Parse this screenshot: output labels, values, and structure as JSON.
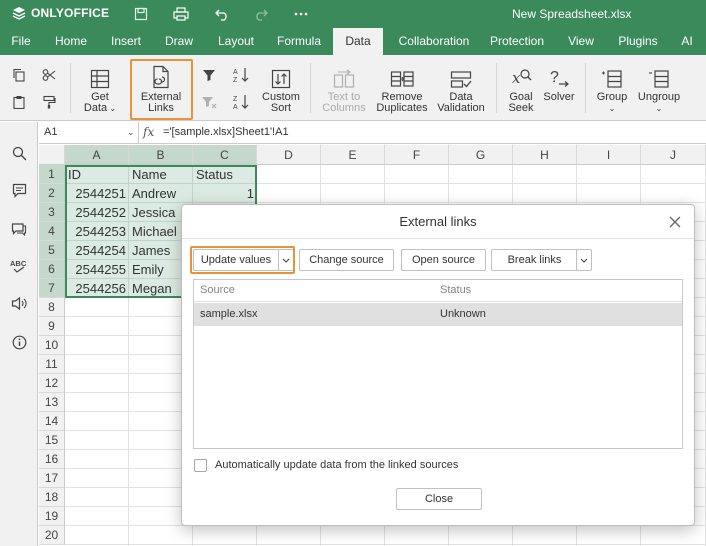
{
  "app": {
    "brand": "ONLYOFFICE",
    "document_title": "New Spreadsheet.xlsx",
    "colors": {
      "accent": "#3a8a5c",
      "highlight": "#e8923a",
      "toolbar_bg": "#f1f1f1"
    }
  },
  "tabs": [
    {
      "label": "File"
    },
    {
      "label": "Home"
    },
    {
      "label": "Insert"
    },
    {
      "label": "Draw"
    },
    {
      "label": "Layout"
    },
    {
      "label": "Formula"
    },
    {
      "label": "Data"
    },
    {
      "label": "Collaboration"
    },
    {
      "label": "Protection"
    },
    {
      "label": "View"
    },
    {
      "label": "Plugins"
    },
    {
      "label": "AI"
    }
  ],
  "active_tab": "Data",
  "toolbar": {
    "get_data": {
      "line1": "Get",
      "line2": "Data"
    },
    "external_links": {
      "line1": "External",
      "line2": "Links"
    },
    "custom_sort": {
      "line1": "Custom",
      "line2": "Sort"
    },
    "text_to_columns": {
      "line1": "Text to",
      "line2": "Columns"
    },
    "remove_duplicates": {
      "line1": "Remove",
      "line2": "Duplicates"
    },
    "data_validation": {
      "line1": "Data",
      "line2": "Validation"
    },
    "goal_seek": {
      "line1": "Goal",
      "line2": "Seek"
    },
    "solver": {
      "line1": "Solver"
    },
    "group": {
      "line1": "Group"
    },
    "ungroup": {
      "line1": "Ungroup"
    }
  },
  "formula_bar": {
    "cell_ref": "A1",
    "fx": "fx",
    "formula": "='[sample.xlsx]Sheet1'!A1"
  },
  "grid": {
    "columns": [
      "A",
      "B",
      "C",
      "D",
      "E",
      "F",
      "G",
      "H",
      "I",
      "J"
    ],
    "rows": [
      "1",
      "2",
      "3",
      "4",
      "5",
      "6",
      "7",
      "8",
      "9",
      "10",
      "11",
      "12",
      "13",
      "14",
      "15",
      "16",
      "17",
      "18",
      "19",
      "20"
    ],
    "data": [
      [
        "ID",
        "Name",
        "Status"
      ],
      [
        "2544251",
        "Andrew",
        "1"
      ],
      [
        "2544252",
        "Jessica",
        ""
      ],
      [
        "2544253",
        "Michael",
        ""
      ],
      [
        "2544254",
        "James",
        ""
      ],
      [
        "2544255",
        "Emily",
        ""
      ],
      [
        "2544256",
        "Megan",
        ""
      ]
    ]
  },
  "dialog": {
    "title": "External links",
    "update_values": "Update values",
    "change_source": "Change source",
    "open_source": "Open source",
    "break_links": "Break links",
    "columns": {
      "source": "Source",
      "status": "Status"
    },
    "rows": [
      {
        "source": "sample.xlsx",
        "status": "Unknown"
      }
    ],
    "auto_update_label": "Automatically update data from the linked sources",
    "auto_update_checked": false,
    "close": "Close"
  }
}
